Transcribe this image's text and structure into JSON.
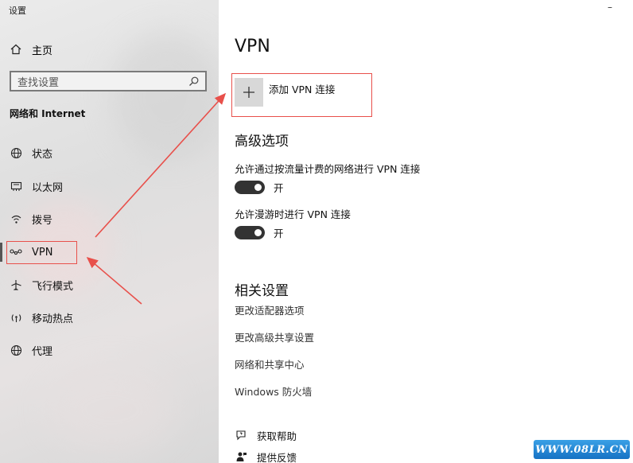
{
  "window": {
    "title": "设置"
  },
  "sidebar": {
    "home_label": "主页",
    "search_placeholder": "查找设置",
    "section_label": "网络和 Internet",
    "items": [
      {
        "label": "状态",
        "icon": "globe-status-icon"
      },
      {
        "label": "以太网",
        "icon": "ethernet-icon"
      },
      {
        "label": "拨号",
        "icon": "dialup-icon"
      },
      {
        "label": "VPN",
        "icon": "vpn-icon",
        "selected": true
      },
      {
        "label": "飞行模式",
        "icon": "airplane-icon"
      },
      {
        "label": "移动热点",
        "icon": "hotspot-icon"
      },
      {
        "label": "代理",
        "icon": "globe-icon"
      }
    ]
  },
  "main": {
    "title": "VPN",
    "add_vpn_label": "添加 VPN 连接",
    "advanced": {
      "heading": "高级选项",
      "metered_label": "允许通过按流量计费的网络进行 VPN 连接",
      "metered_state": "开",
      "roaming_label": "允许漫游时进行 VPN 连接",
      "roaming_state": "开"
    },
    "related": {
      "heading": "相关设置",
      "links": [
        "更改适配器选项",
        "更改高级共享设置",
        "网络和共享中心",
        "Windows 防火墙"
      ]
    },
    "help": {
      "get_help": "获取帮助",
      "feedback": "提供反馈"
    }
  },
  "watermark": {
    "text": "WWW.08LR.CN"
  },
  "colors": {
    "annotation_red": "#e8504b",
    "toggle_on": "#333333",
    "watermark_blue": "#1f7fd2"
  }
}
